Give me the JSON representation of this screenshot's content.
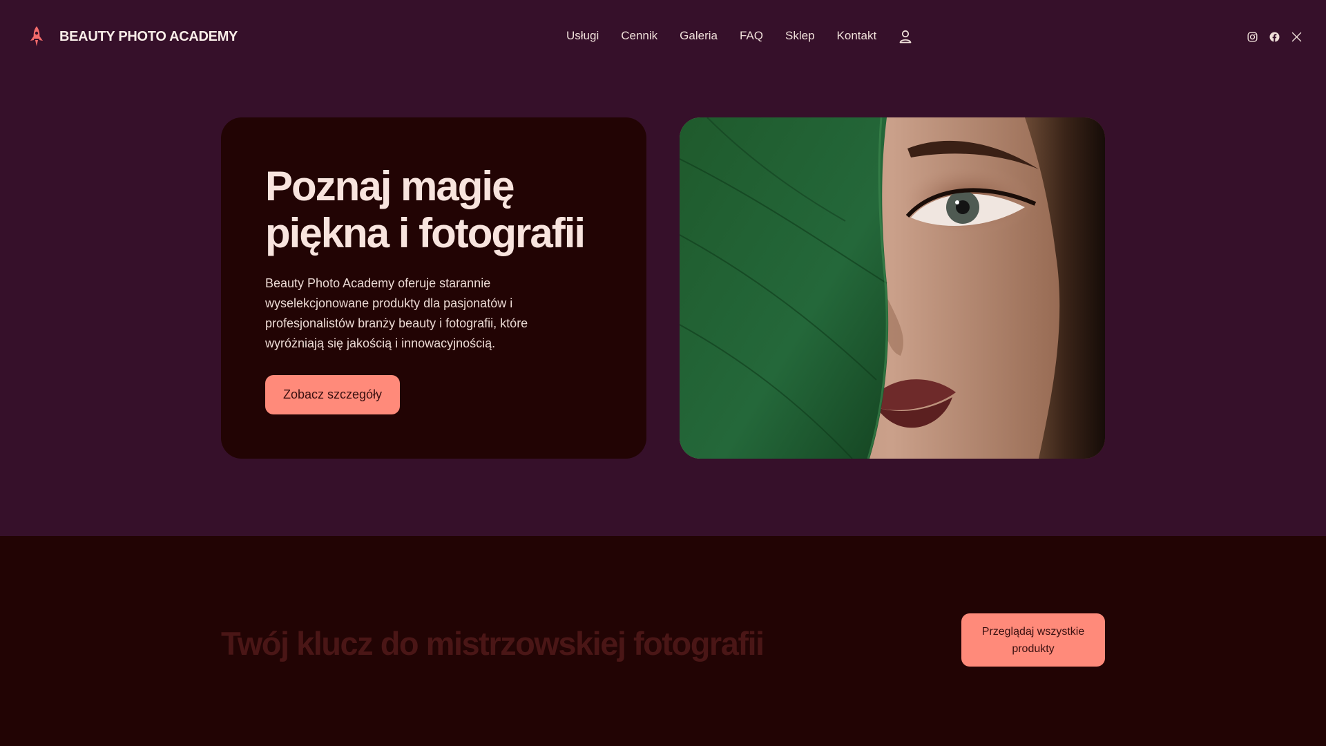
{
  "header": {
    "brand_name": "BEAUTY PHOTO ACADEMY",
    "logo_icon": "rocket-icon",
    "nav": [
      "Usługi",
      "Cennik",
      "Galeria",
      "FAQ",
      "Sklep",
      "Kontakt"
    ],
    "account_icon": "user-icon",
    "social_icons": [
      "instagram-icon",
      "facebook-icon",
      "x-icon"
    ]
  },
  "hero": {
    "title_line1": "Poznaj magię",
    "title_line2": "piękna i fotografii",
    "description": "Beauty Photo Academy oferuje starannie wyselekcjonowane produkty dla pasjonatów i profesjonalistów branży beauty i fotografii, które wyróżniają się jakością i innowacyjnością.",
    "cta_label": "Zobacz szczegóły"
  },
  "lower": {
    "title": "Twój klucz do mistrzowskiej fotografii",
    "cta_label": "Przeglądaj wszystkie produkty"
  },
  "colors": {
    "page_bg": "#36102a",
    "card_bg": "#220404",
    "accent": "#ff8a7a",
    "heading": "#f8e4de",
    "muted_heading": "#4a1616"
  }
}
